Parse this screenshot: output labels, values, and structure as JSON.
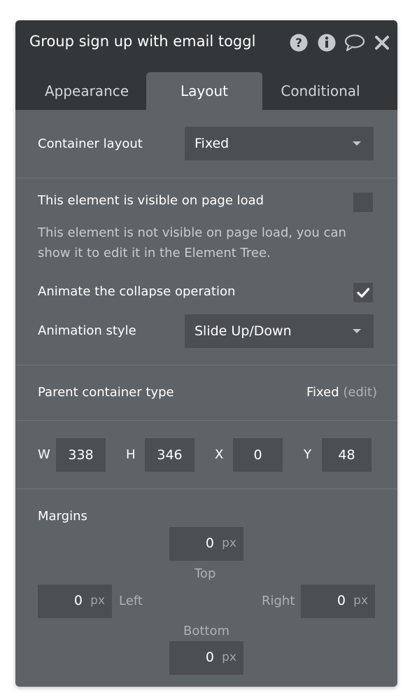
{
  "header": {
    "title": "Group sign up with email toggl",
    "icons": [
      "help-icon",
      "info-icon",
      "comment-icon",
      "close-icon"
    ]
  },
  "tabs": [
    {
      "label": "Appearance",
      "active": false
    },
    {
      "label": "Layout",
      "active": true
    },
    {
      "label": "Conditional",
      "active": false
    }
  ],
  "container_layout": {
    "label": "Container layout",
    "value": "Fixed"
  },
  "visibility": {
    "label": "This element is visible on page load",
    "checked": false,
    "help_line1": "This element is not visible on page load, you can",
    "help_line2": "show it to edit it in the Element Tree."
  },
  "animate": {
    "label": "Animate the collapse operation",
    "checked": true
  },
  "animation_style": {
    "label": "Animation style",
    "value": "Slide Up/Down"
  },
  "parent_container": {
    "label": "Parent container type",
    "value": "Fixed",
    "edit": "(edit)"
  },
  "dimensions": {
    "w_label": "W",
    "w": "338",
    "h_label": "H",
    "h": "346",
    "x_label": "X",
    "x": "0",
    "y_label": "Y",
    "y": "48"
  },
  "margins": {
    "title": "Margins",
    "unit": "px",
    "top_label": "Top",
    "top": "0",
    "left_label": "Left",
    "left": "0",
    "right_label": "Right",
    "right": "0",
    "bottom_label": "Bottom",
    "bottom": "0"
  },
  "colors": {
    "panel": "#5e6367",
    "header": "#33373a",
    "input": "#4b4f53"
  }
}
